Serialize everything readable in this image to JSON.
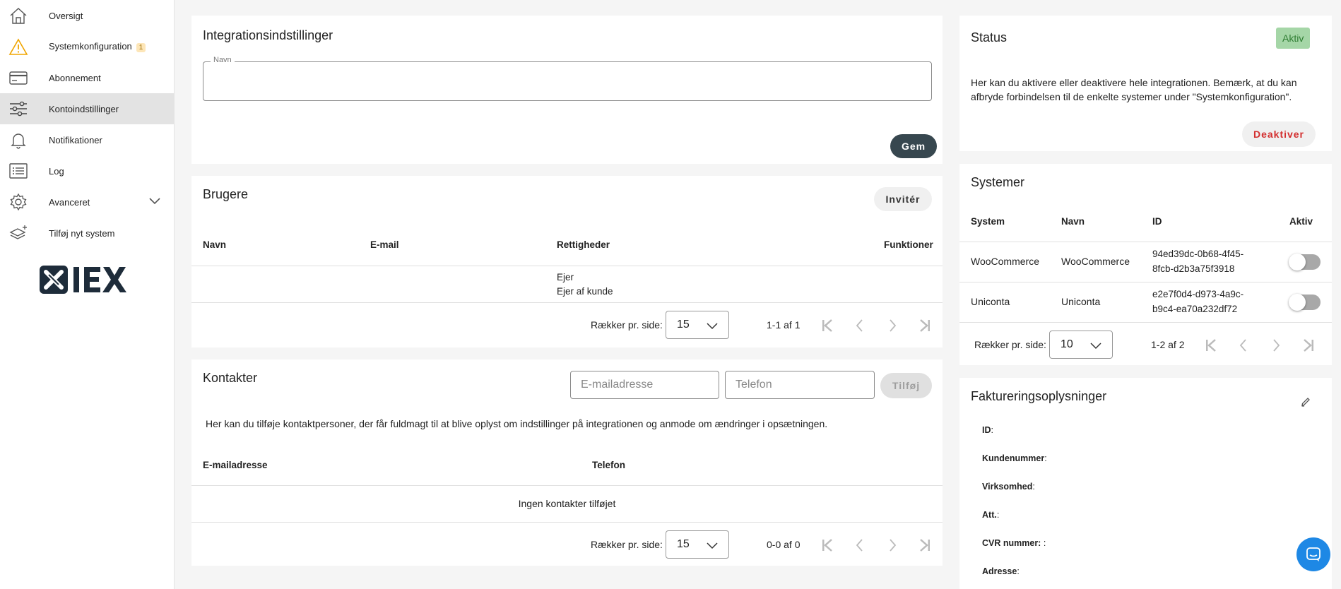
{
  "sidebar": {
    "items": [
      {
        "label": "Oversigt",
        "icon": "home-icon"
      },
      {
        "label": "Systemkonfiguration",
        "icon": "warning-icon",
        "badge": "1"
      },
      {
        "label": "Abonnement",
        "icon": "credit-card-icon"
      },
      {
        "label": "Kontoindstillinger",
        "icon": "sliders-icon",
        "active": true
      },
      {
        "label": "Notifikationer",
        "icon": "bell-icon"
      },
      {
        "label": "Log",
        "icon": "list-icon"
      },
      {
        "label": "Avanceret",
        "icon": "gear-icon"
      },
      {
        "label": "Tilføj nyt system",
        "icon": "add-layer-icon"
      }
    ],
    "logo_text": "IEX"
  },
  "integration": {
    "title": "Integrationsindstillinger",
    "name_legend": "Navn",
    "name_value": "",
    "save_label": "Gem"
  },
  "users": {
    "title": "Brugere",
    "invite_label": "Invitér",
    "columns": [
      "Navn",
      "E-mail",
      "Rettigheder",
      "Funktioner"
    ],
    "rows": [
      {
        "name": "",
        "email": "",
        "rights": [
          "Ejer",
          "Ejer af kunde"
        ]
      }
    ],
    "pagination": {
      "rows_label": "Rækker pr. side:",
      "rows_per_page": "15",
      "range": "1-1 af 1"
    }
  },
  "contacts": {
    "title": "Kontakter",
    "email_placeholder": "E-mailadresse",
    "phone_placeholder": "Telefon",
    "add_label": "Tilføj",
    "description": "Her kan du tilføje kontaktpersoner, der får fuldmagt til at blive oplyst om indstillinger på integrationen og anmode om ændringer i opsætningen.",
    "columns": [
      "E-mailadresse",
      "Telefon"
    ],
    "empty_text": "Ingen kontakter tilføjet",
    "pagination": {
      "rows_label": "Rækker pr. side:",
      "rows_per_page": "15",
      "range": "0-0 af 0"
    }
  },
  "status": {
    "title": "Status",
    "chip": "Aktiv",
    "chip_color": "#a5d6a7",
    "description": "Her kan du aktivere eller deaktivere hele integrationen. Bemærk, at du kan afbryde forbindelsen til de enkelte systemer under \"Systemkonfiguration\".",
    "deactivate_label": "Deaktiver",
    "deactivate_color": "#d32f2f"
  },
  "systems": {
    "title": "Systemer",
    "columns": [
      "System",
      "Navn",
      "ID",
      "Aktiv"
    ],
    "rows": [
      {
        "system": "WooCommerce",
        "name": "WooCommerce",
        "id_line1": "94ed39dc-0b68-4f45-",
        "id_line2": "8fcb-d2b3a75f3918",
        "active": false
      },
      {
        "system": "Uniconta",
        "name": "Uniconta",
        "id_line1": "e2e7f0d4-d973-4a9c-",
        "id_line2": "b9c4-ea70a232df72",
        "active": false
      }
    ],
    "pagination": {
      "rows_label": "Rækker pr. side:",
      "rows_per_page": "10",
      "range": "1-2 af 2"
    }
  },
  "billing": {
    "title": "Faktureringsoplysninger",
    "fields": [
      {
        "label": "ID",
        "suffix": ":"
      },
      {
        "label": "Kundenummer",
        "suffix": ":"
      },
      {
        "label": "Virksomhed",
        "suffix": ":"
      },
      {
        "label": "Att.",
        "suffix": ":"
      },
      {
        "label": "CVR nummer:",
        "suffix": " :"
      },
      {
        "label": "Adresse",
        "suffix": ":"
      }
    ]
  }
}
